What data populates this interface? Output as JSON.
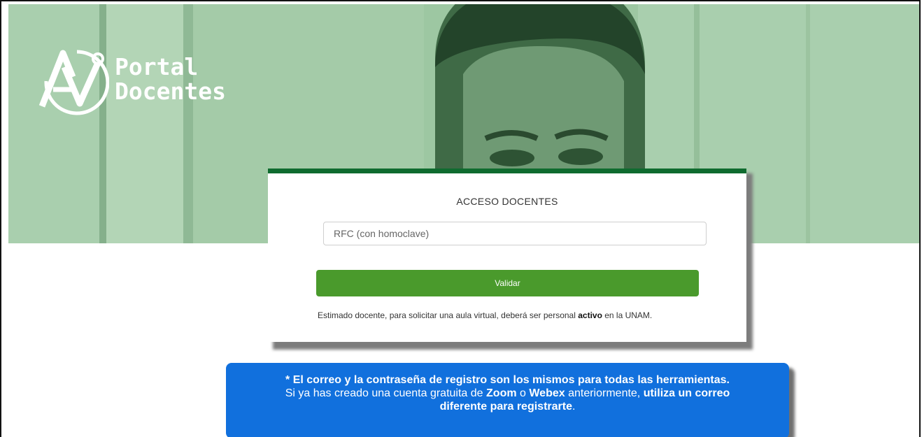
{
  "logo": {
    "line1": "Portal",
    "line2": "Docentes"
  },
  "login": {
    "title": "ACCESO DOCENTES",
    "rfc_placeholder": "RFC (con homoclave)",
    "validate_label": "Validar",
    "notice_prefix": "Estimado docente, para solicitar una aula virtual, deberá ser personal ",
    "notice_bold": "activo",
    "notice_suffix": " en la UNAM."
  },
  "info": {
    "line1_bold": "* El correo y la contraseña de registro son los mismos para todas las herramientas.",
    "line2_part1": "Si ya has creado una cuenta gratuita de ",
    "line2_zoom": "Zoom",
    "line2_part2": " o ",
    "line2_webex": "Webex",
    "line2_part3": " anteriormente, ",
    "line2_bold": "utiliza un correo",
    "line3_bold": "diferente para registrarte",
    "line3_end": "."
  },
  "colors": {
    "brand_green": "#0f6b2f",
    "button_green": "#4a9a2c",
    "info_blue": "#1170dd",
    "hero_tint": "#9dc7a2"
  },
  "icons": {
    "logo": "av-logo-icon"
  }
}
